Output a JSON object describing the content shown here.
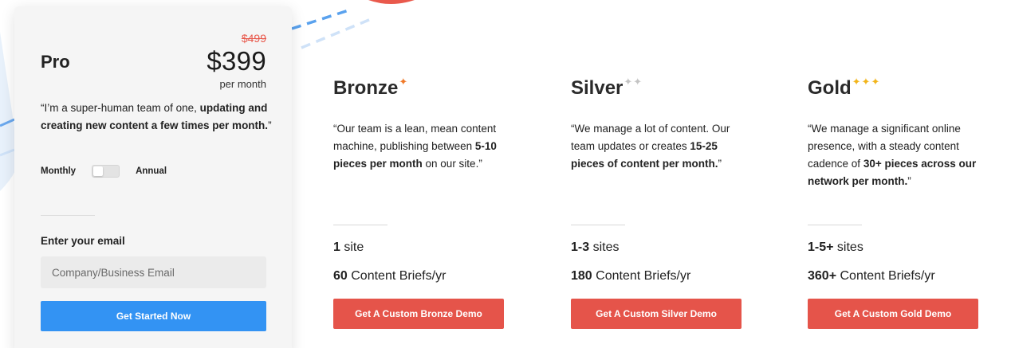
{
  "colors": {
    "accent_blue": "#3393f3",
    "accent_red": "#e5544a",
    "strike_red": "#e8584b",
    "star_orange": "#f07a2a",
    "star_gray": "#c4c4c4",
    "star_gold": "#f2b51c"
  },
  "pro": {
    "title": "Pro",
    "old_price": "$499",
    "price": "$399",
    "period": "per month",
    "quote_start": "“I’m a super-human team of one, ",
    "quote_bold": "updating and creating new content a few times per month.",
    "quote_end": "”",
    "billing_monthly": "Monthly",
    "billing_annual": "Annual",
    "email_label": "Enter your email",
    "email_placeholder": "Company/Business Email",
    "cta": "Get Started Now"
  },
  "tiers": [
    {
      "name": "Bronze",
      "stars": "✦",
      "star_icon": "orange-sparkle-icon",
      "quote_start": "“Our team is a lean, mean content machine, publishing between ",
      "quote_bold": "5-10 pieces per month",
      "quote_end": " on our site.”",
      "sites_bold": "1",
      "sites_text": " site",
      "briefs_bold": "60",
      "briefs_text": " Content Briefs/yr",
      "cta": "Get A Custom Bronze Demo"
    },
    {
      "name": "Silver",
      "stars": "✦✦",
      "star_icon": "gray-sparkle-icon",
      "quote_start": "“We manage a lot of content. Our team updates or creates ",
      "quote_bold": "15-25 pieces of content per month.",
      "quote_end": "”",
      "sites_bold": "1-3",
      "sites_text": " sites",
      "briefs_bold": "180",
      "briefs_text": " Content Briefs/yr",
      "cta": "Get A Custom Silver Demo"
    },
    {
      "name": "Gold",
      "stars": "✦✦✦",
      "star_icon": "gold-sparkle-icon",
      "quote_start": "“We manage a significant online presence, with a steady content cadence of ",
      "quote_bold": "30+ pieces across our network per month.",
      "quote_end": "”",
      "sites_bold": "1-5+",
      "sites_text": " sites",
      "briefs_bold": "360+",
      "briefs_text": " Content Briefs/yr",
      "cta": "Get A Custom Gold Demo"
    }
  ]
}
